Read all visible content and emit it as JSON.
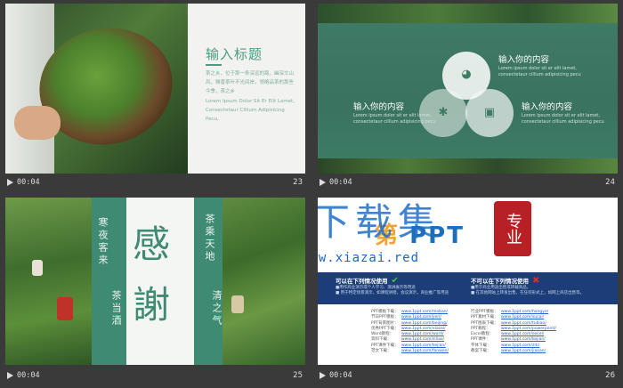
{
  "slides": [
    {
      "title": "输入标题",
      "paragraphs": [
        "茶之乡，位于那一条深远的路，幽深文山风，雅香茶叶不光间岸，领略品茶的那些今季，茶之乡",
        "Lorem Ipsum Dolor Sit Er Elit Lamet, Consectetaur Cillium Adipisicing Pecu,"
      ],
      "time": "00:04",
      "number": "23"
    },
    {
      "blocks": [
        {
          "heading": "输入你的内容",
          "desc": "Lorem ipsum dolor sit er elit lamet, consectetaur cillium adipisicing pecu"
        },
        {
          "heading": "输入你的内容",
          "desc": "Lorem ipsum dolor sit er elit lamet, consectetaur cillium adipisicing pecu"
        },
        {
          "heading": "输入你的内容",
          "desc": "Lorem ipsum dolor sit er elit lamet, consectetaur cillium adipisicing pecu"
        }
      ],
      "icons": [
        "chart-icon",
        "gear-icon",
        "camera-icon"
      ],
      "time": "00:04",
      "number": "24"
    },
    {
      "col1": "寒夜客来",
      "col2": "茶当酒",
      "big1": "感",
      "big2": "謝",
      "col3": "茶乘天地",
      "col4": "清之气",
      "time": "00:04",
      "number": "25"
    },
    {
      "watermark": "下载集",
      "brand_a": "第",
      "brand_b": "PPT",
      "seal": "专业",
      "url": "www.xiazai.red",
      "can_title": "不可以在下列情况使用",
      "can_do_title": "可以在下列情况使用",
      "can_lines": [
        "■用作商业演示或个人学习、演讲展示等用途",
        "■ 用于特定场景演示，如课程讲授，会议演示，商业推广等用途"
      ],
      "cannot_lines": [
        "■用于商业用途出售或转载商品。",
        "■ 在其他网站上转发出售。在任何形式上，如网上商店出售等。"
      ],
      "link_keys": [
        "PPT模板下载：",
        "节日PPT模板：",
        "PPT背景图片：",
        "优秀PPT下载：",
        "Word教程：",
        "资料下载：",
        "PPT课件下载：",
        "范文下载："
      ],
      "link_vals": [
        "www.1ppt.com/moban/",
        "www.1ppt.com/jieri/",
        "www.1ppt.com/beijing/",
        "www.1ppt.com/xiazai/",
        "www.1ppt.com/word/",
        "www.1ppt.com/ziliao/",
        "www.1ppt.com/kejian/",
        "www.1ppt.com/fanwen/"
      ],
      "link_keys2": [
        "行业PPT模板：",
        "PPT素材下载：",
        "PPT图表下载：",
        "PPT教程：",
        "Excel教程：",
        "PPT课件：",
        "字体下载：",
        "教案下载："
      ],
      "link_vals2": [
        "www.1ppt.com/hangye/",
        "www.1ppt.com/sucai/",
        "www.1ppt.com/tubiao/",
        "www.1ppt.com/powerpoint/",
        "www.1ppt.com/excel/",
        "www.1ppt.com/kejian/",
        "www.1ppt.com/ziti/",
        "www.1ppt.com/jiaoan/"
      ],
      "time": "00:04",
      "number": "26"
    }
  ]
}
